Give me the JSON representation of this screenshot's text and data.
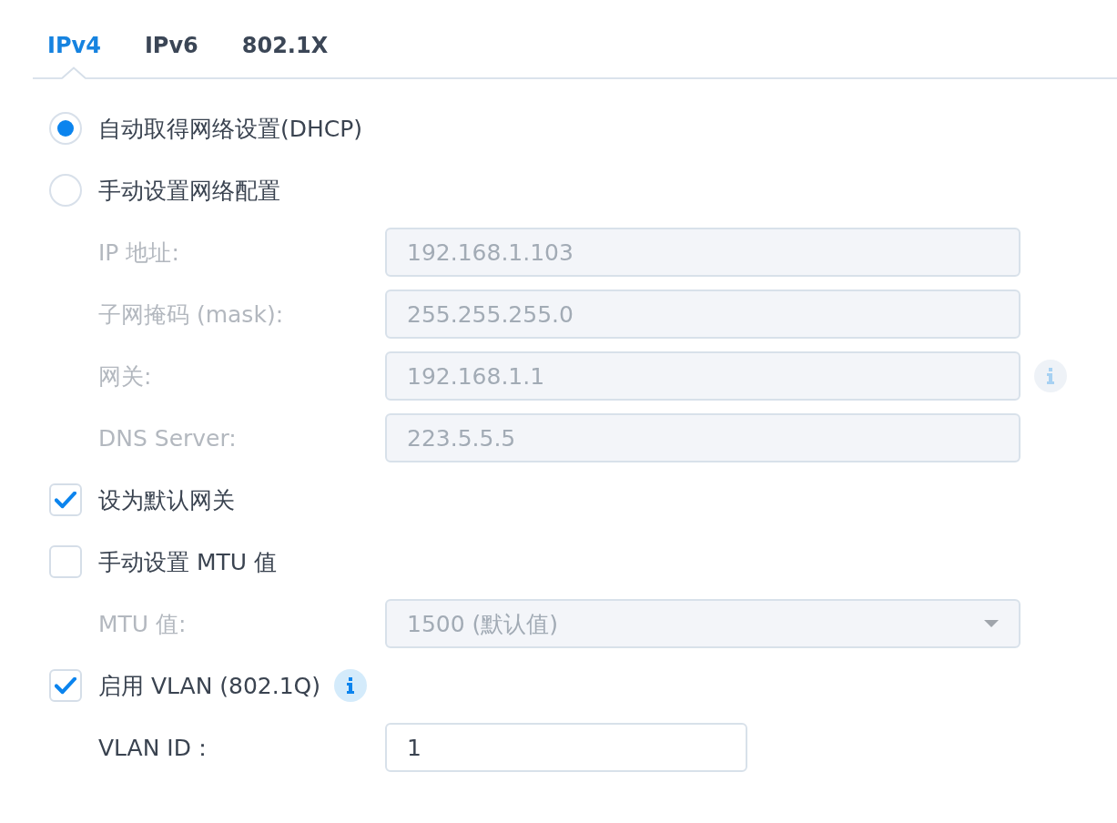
{
  "tabs": [
    {
      "label": "IPv4",
      "selected": true
    },
    {
      "label": "IPv6",
      "selected": false
    },
    {
      "label": "802.1X",
      "selected": false
    }
  ],
  "rows": [
    {
      "kind": "radio",
      "label": "自动取得网络设置(DHCP)",
      "selected": true,
      "disabled": false,
      "info": false
    },
    {
      "kind": "radio",
      "label": "手动设置网络配置",
      "selected": false,
      "disabled": false,
      "info": false
    },
    {
      "kind": "text",
      "label": "IP 地址:",
      "value": "192.168.1.103",
      "disabled": true,
      "info": false
    },
    {
      "kind": "text",
      "label": "子网掩码 (mask):",
      "value": "255.255.255.0",
      "disabled": true,
      "info": false
    },
    {
      "kind": "text",
      "label": "网关:",
      "value": "192.168.1.1",
      "disabled": true,
      "info": true
    },
    {
      "kind": "text",
      "label": "DNS Server:",
      "value": "223.5.5.5",
      "disabled": true,
      "info": false
    },
    {
      "kind": "checkbox",
      "label": "设为默认网关",
      "checked": true,
      "disabled": false,
      "info": false
    },
    {
      "kind": "checkbox",
      "label": "手动设置 MTU 值",
      "checked": false,
      "disabled": false,
      "info": false
    },
    {
      "kind": "dropdown",
      "label": "MTU 值:",
      "value": "1500 (默认值)",
      "disabled": true,
      "info": false
    },
    {
      "kind": "checkbox",
      "label": "启用 VLAN (802.1Q)",
      "checked": true,
      "disabled": false,
      "info": true
    },
    {
      "kind": "number",
      "label": "VLAN ID：",
      "value": "1",
      "disabled": false,
      "info": false
    }
  ]
}
